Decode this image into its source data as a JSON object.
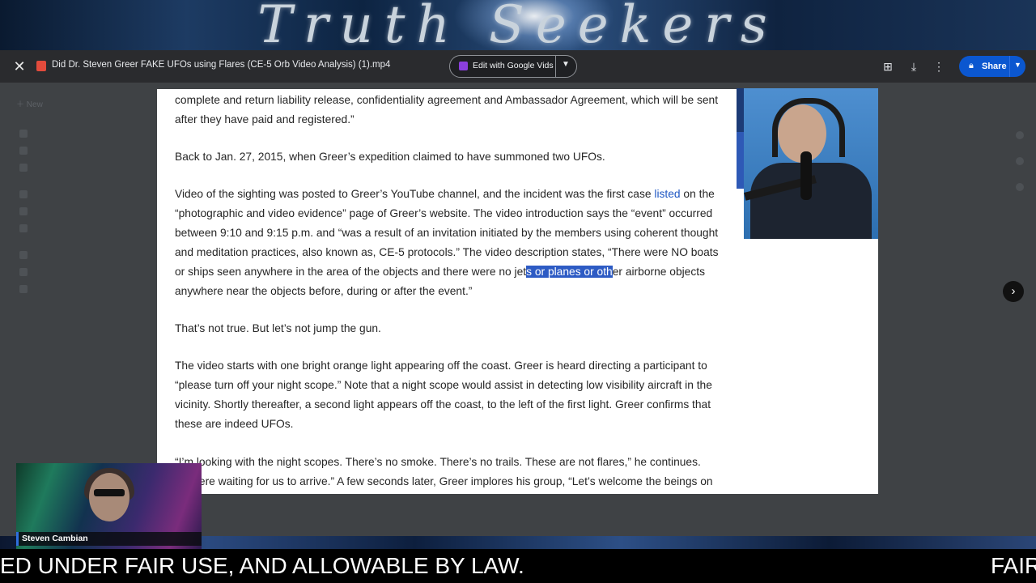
{
  "banner": {
    "title": "Truth Seekers"
  },
  "viewer": {
    "file_title": "Did Dr. Steven Greer FAKE UFOs using Flares (CE-5 Orb Video Analysis) (1).mp4",
    "edit_button": "Edit with Google Vids",
    "share_button": "Share"
  },
  "background_ui": {
    "new_label": "New"
  },
  "document": {
    "p1": [
      "complete and return liability release, confidentiality agreement and Ambassador Agreement, which will be sent",
      "after they have paid and registered.”"
    ],
    "p2": "Back to Jan. 27, 2015, when Greer’s expedition claimed to have summoned two UFOs.",
    "p3": {
      "l1_pre": "Video of the sighting was posted to Greer’s YouTube channel, and the incident was the first case ",
      "l1_link": "listed",
      "l1_post": " on the",
      "l2": "“photographic and video evidence” page of Greer’s website. The video introduction says the “event” occurred",
      "l3": "between 9:10 and 9:15 p.m. and “was a result of an invitation initiated by the members using coherent thought",
      "l4": "and meditation practices, also known as, CE-5 protocols.” The video description states, “There were NO boats",
      "l5_pre": "or ships seen anywhere in the area of the objects and there were no jet",
      "l5_hl": "s or planes or oth",
      "l5_post": "er airborne objects",
      "l6": "anywhere near the objects before, during or after the event.”"
    },
    "p4": "That’s not true. But let’s not jump the gun.",
    "p5": [
      "The video starts with one bright orange light appearing off the coast. Greer is heard directing a participant to",
      "“please turn off your night scope.” Note that a night scope would assist in detecting low visibility aircraft in the",
      "vicinity. Shortly thereafter, a second light appears off the coast, to the left of the first light. Greer confirms that",
      "these are indeed UFOs."
    ],
    "p6": [
      "“I’m looking with the night scopes. There’s no smoke. There’s no trails. These are not flares,” he continues.",
      "“... were waiting for us to arrive.” A few seconds later, Greer implores his group, “Let’s welcome the beings on"
    ]
  },
  "overlay": {
    "presenter_name": "Steven Cambian"
  },
  "ticker": {
    "text_left": "ED UNDER FAIR USE, AND ALLOWABLE BY LAW.",
    "text_right": "FAIR"
  },
  "colors": {
    "highlight": "#2d5bc4",
    "link": "#1f57c3",
    "share": "#0b57d0"
  },
  "icons": [
    "close-icon",
    "video-file-icon",
    "vids-icon",
    "chevron-down-icon",
    "add-comment-icon",
    "download-icon",
    "more-vert-icon",
    "lock-icon",
    "chevron-right-icon"
  ]
}
